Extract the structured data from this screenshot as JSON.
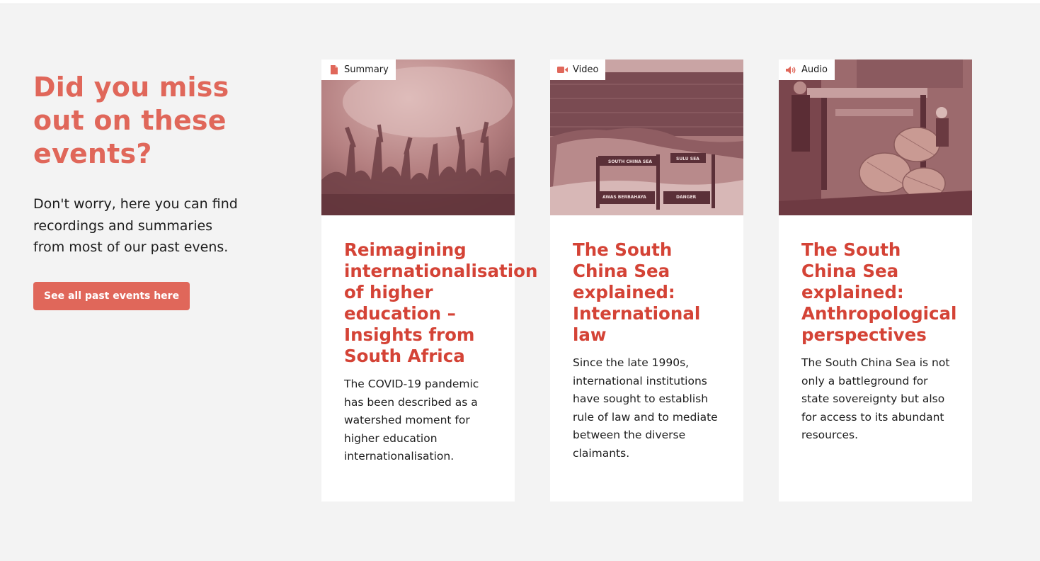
{
  "intro": {
    "heading": "Did you miss out on these events?",
    "body": "Don't worry, here you can find recordings and summaries from most of our past evens.",
    "button_label": "See all past events here"
  },
  "colors": {
    "accent": "#e0675a",
    "title_red": "#d44336",
    "background": "#f3f3f3",
    "card": "#ffffff"
  },
  "cards": [
    {
      "tag": "Summary",
      "tag_icon": "document-icon",
      "title": "Reimagining internationalisation of higher education – Insights from South Africa",
      "description": "The COVID-19 pandemic has been described as a watershed moment for higher education internationalisation."
    },
    {
      "tag": "Video",
      "tag_icon": "video-camera-icon",
      "title": "The South China Sea explained: International law",
      "description": "Since the late 1990s, international institutions have sought to establish rule of law and to mediate between the diverse claimants.",
      "image_sign_left": "SOUTH CHINA SEA",
      "image_sign_right": "SULU SEA",
      "image_warning_left": "AWAS BERBAHAYA",
      "image_warning_right": "DANGER"
    },
    {
      "tag": "Audio",
      "tag_icon": "speaker-icon",
      "title": "The South China Sea explained: Anthropological perspectives",
      "description": "The South China Sea is not only a battleground for state sovereignty but also for access to its abundant resources."
    }
  ]
}
